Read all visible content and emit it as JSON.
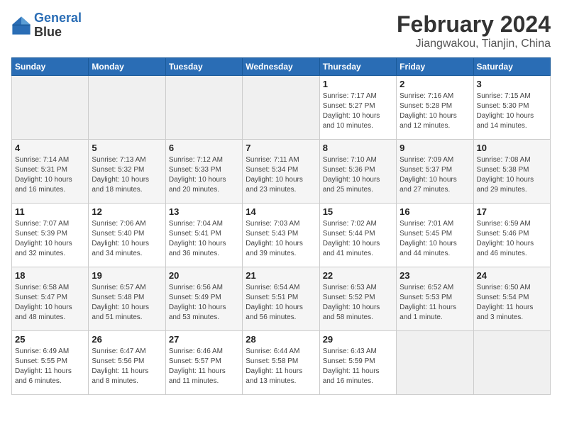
{
  "logo": {
    "line1": "General",
    "line2": "Blue"
  },
  "title": "February 2024",
  "subtitle": "Jiangwakou, Tianjin, China",
  "days_of_week": [
    "Sunday",
    "Monday",
    "Tuesday",
    "Wednesday",
    "Thursday",
    "Friday",
    "Saturday"
  ],
  "weeks": [
    [
      {
        "day": "",
        "info": ""
      },
      {
        "day": "",
        "info": ""
      },
      {
        "day": "",
        "info": ""
      },
      {
        "day": "",
        "info": ""
      },
      {
        "day": "1",
        "info": "Sunrise: 7:17 AM\nSunset: 5:27 PM\nDaylight: 10 hours\nand 10 minutes."
      },
      {
        "day": "2",
        "info": "Sunrise: 7:16 AM\nSunset: 5:28 PM\nDaylight: 10 hours\nand 12 minutes."
      },
      {
        "day": "3",
        "info": "Sunrise: 7:15 AM\nSunset: 5:30 PM\nDaylight: 10 hours\nand 14 minutes."
      }
    ],
    [
      {
        "day": "4",
        "info": "Sunrise: 7:14 AM\nSunset: 5:31 PM\nDaylight: 10 hours\nand 16 minutes."
      },
      {
        "day": "5",
        "info": "Sunrise: 7:13 AM\nSunset: 5:32 PM\nDaylight: 10 hours\nand 18 minutes."
      },
      {
        "day": "6",
        "info": "Sunrise: 7:12 AM\nSunset: 5:33 PM\nDaylight: 10 hours\nand 20 minutes."
      },
      {
        "day": "7",
        "info": "Sunrise: 7:11 AM\nSunset: 5:34 PM\nDaylight: 10 hours\nand 23 minutes."
      },
      {
        "day": "8",
        "info": "Sunrise: 7:10 AM\nSunset: 5:36 PM\nDaylight: 10 hours\nand 25 minutes."
      },
      {
        "day": "9",
        "info": "Sunrise: 7:09 AM\nSunset: 5:37 PM\nDaylight: 10 hours\nand 27 minutes."
      },
      {
        "day": "10",
        "info": "Sunrise: 7:08 AM\nSunset: 5:38 PM\nDaylight: 10 hours\nand 29 minutes."
      }
    ],
    [
      {
        "day": "11",
        "info": "Sunrise: 7:07 AM\nSunset: 5:39 PM\nDaylight: 10 hours\nand 32 minutes."
      },
      {
        "day": "12",
        "info": "Sunrise: 7:06 AM\nSunset: 5:40 PM\nDaylight: 10 hours\nand 34 minutes."
      },
      {
        "day": "13",
        "info": "Sunrise: 7:04 AM\nSunset: 5:41 PM\nDaylight: 10 hours\nand 36 minutes."
      },
      {
        "day": "14",
        "info": "Sunrise: 7:03 AM\nSunset: 5:43 PM\nDaylight: 10 hours\nand 39 minutes."
      },
      {
        "day": "15",
        "info": "Sunrise: 7:02 AM\nSunset: 5:44 PM\nDaylight: 10 hours\nand 41 minutes."
      },
      {
        "day": "16",
        "info": "Sunrise: 7:01 AM\nSunset: 5:45 PM\nDaylight: 10 hours\nand 44 minutes."
      },
      {
        "day": "17",
        "info": "Sunrise: 6:59 AM\nSunset: 5:46 PM\nDaylight: 10 hours\nand 46 minutes."
      }
    ],
    [
      {
        "day": "18",
        "info": "Sunrise: 6:58 AM\nSunset: 5:47 PM\nDaylight: 10 hours\nand 48 minutes."
      },
      {
        "day": "19",
        "info": "Sunrise: 6:57 AM\nSunset: 5:48 PM\nDaylight: 10 hours\nand 51 minutes."
      },
      {
        "day": "20",
        "info": "Sunrise: 6:56 AM\nSunset: 5:49 PM\nDaylight: 10 hours\nand 53 minutes."
      },
      {
        "day": "21",
        "info": "Sunrise: 6:54 AM\nSunset: 5:51 PM\nDaylight: 10 hours\nand 56 minutes."
      },
      {
        "day": "22",
        "info": "Sunrise: 6:53 AM\nSunset: 5:52 PM\nDaylight: 10 hours\nand 58 minutes."
      },
      {
        "day": "23",
        "info": "Sunrise: 6:52 AM\nSunset: 5:53 PM\nDaylight: 11 hours\nand 1 minute."
      },
      {
        "day": "24",
        "info": "Sunrise: 6:50 AM\nSunset: 5:54 PM\nDaylight: 11 hours\nand 3 minutes."
      }
    ],
    [
      {
        "day": "25",
        "info": "Sunrise: 6:49 AM\nSunset: 5:55 PM\nDaylight: 11 hours\nand 6 minutes."
      },
      {
        "day": "26",
        "info": "Sunrise: 6:47 AM\nSunset: 5:56 PM\nDaylight: 11 hours\nand 8 minutes."
      },
      {
        "day": "27",
        "info": "Sunrise: 6:46 AM\nSunset: 5:57 PM\nDaylight: 11 hours\nand 11 minutes."
      },
      {
        "day": "28",
        "info": "Sunrise: 6:44 AM\nSunset: 5:58 PM\nDaylight: 11 hours\nand 13 minutes."
      },
      {
        "day": "29",
        "info": "Sunrise: 6:43 AM\nSunset: 5:59 PM\nDaylight: 11 hours\nand 16 minutes."
      },
      {
        "day": "",
        "info": ""
      },
      {
        "day": "",
        "info": ""
      }
    ]
  ]
}
